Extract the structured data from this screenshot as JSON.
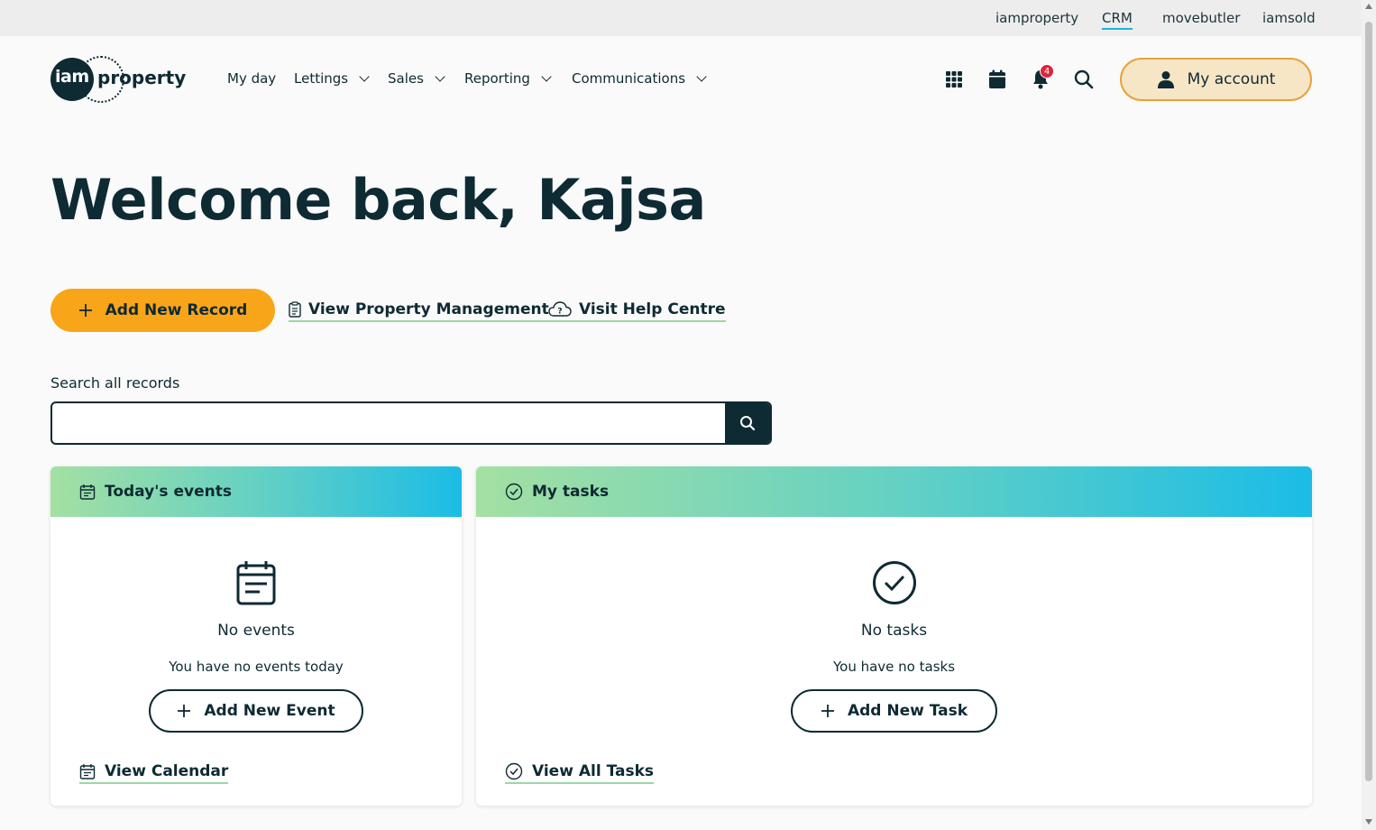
{
  "top_links": [
    "iamproperty",
    "CRM",
    "movebutler",
    "iamsold"
  ],
  "logo": {
    "part1": "iam",
    "part2": "property"
  },
  "nav": {
    "my_day": "My day",
    "lettings": "Lettings",
    "sales": "Sales",
    "reporting": "Reporting",
    "communications": "Communications"
  },
  "notifications": {
    "count": "4"
  },
  "account": {
    "label": "My account"
  },
  "welcome": "Welcome back, Kajsa",
  "actions": {
    "add_record": "Add New Record",
    "view_property_management": "View Property Management",
    "visit_help_centre": "Visit Help Centre"
  },
  "search": {
    "label": "Search all records",
    "value": ""
  },
  "events_card": {
    "title": "Today's events",
    "empty_title": "No events",
    "empty_sub": "You have no events today",
    "add_button": "Add New Event",
    "footer_link": "View Calendar"
  },
  "tasks_card": {
    "title": "My tasks",
    "empty_title": "No tasks",
    "empty_sub": "You have no tasks",
    "add_button": "Add New Task",
    "footer_link": "View All Tasks"
  },
  "colors": {
    "primary_dark": "#0e2a33",
    "accent_orange": "#f9a51a",
    "account_bg": "#f7e6c6",
    "badge_red": "#d9263a",
    "link_underline": "#9ad8a4"
  }
}
